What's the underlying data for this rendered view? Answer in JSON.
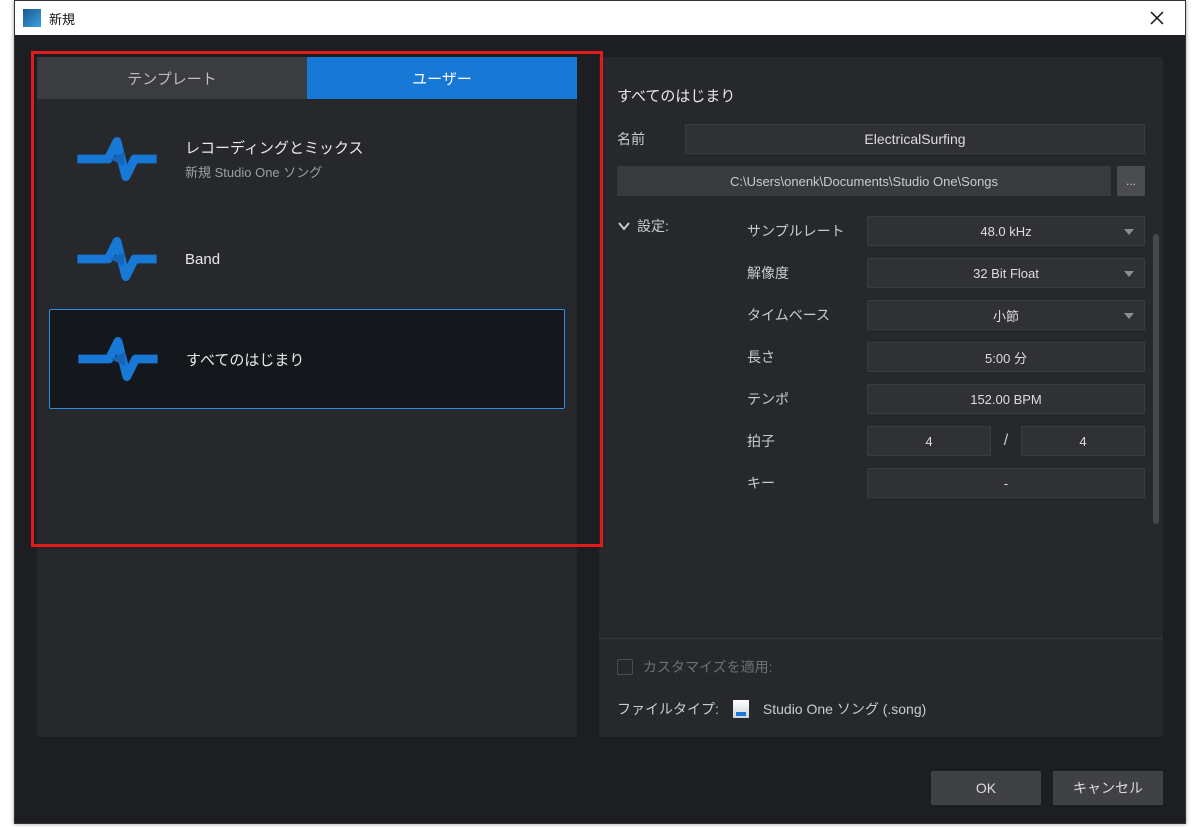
{
  "window": {
    "title": "新規"
  },
  "tabs": {
    "template": "テンプレート",
    "user": "ユーザー"
  },
  "templates": [
    {
      "title": "レコーディングとミックス",
      "sub": "新規 Studio One ソング"
    },
    {
      "title": "Band",
      "sub": ""
    },
    {
      "title": "すべてのはじまり",
      "sub": ""
    }
  ],
  "selected_template_title": "すべてのはじまり",
  "form": {
    "name_label": "名前",
    "name_value": "ElectricalSurfing",
    "path": "C:\\Users\\onenk\\Documents\\Studio One\\Songs",
    "browse": "...",
    "settings_label": "設定:",
    "sample_rate_label": "サンプルレート",
    "sample_rate": "48.0 kHz",
    "resolution_label": "解像度",
    "resolution": "32 Bit Float",
    "timebase_label": "タイムベース",
    "timebase": "小節",
    "length_label": "長さ",
    "length": "5:00 分",
    "tempo_label": "テンポ",
    "tempo": "152.00 BPM",
    "sig_label": "拍子",
    "sig_num": "4",
    "sig_sep": "/",
    "sig_den": "4",
    "key_label": "キー",
    "key": "-",
    "customize_label": "カスタマイズを適用:",
    "filetype_label": "ファイルタイプ:",
    "filetype_value": "Studio One ソング (.song)"
  },
  "buttons": {
    "ok": "OK",
    "cancel": "キャンセル"
  }
}
